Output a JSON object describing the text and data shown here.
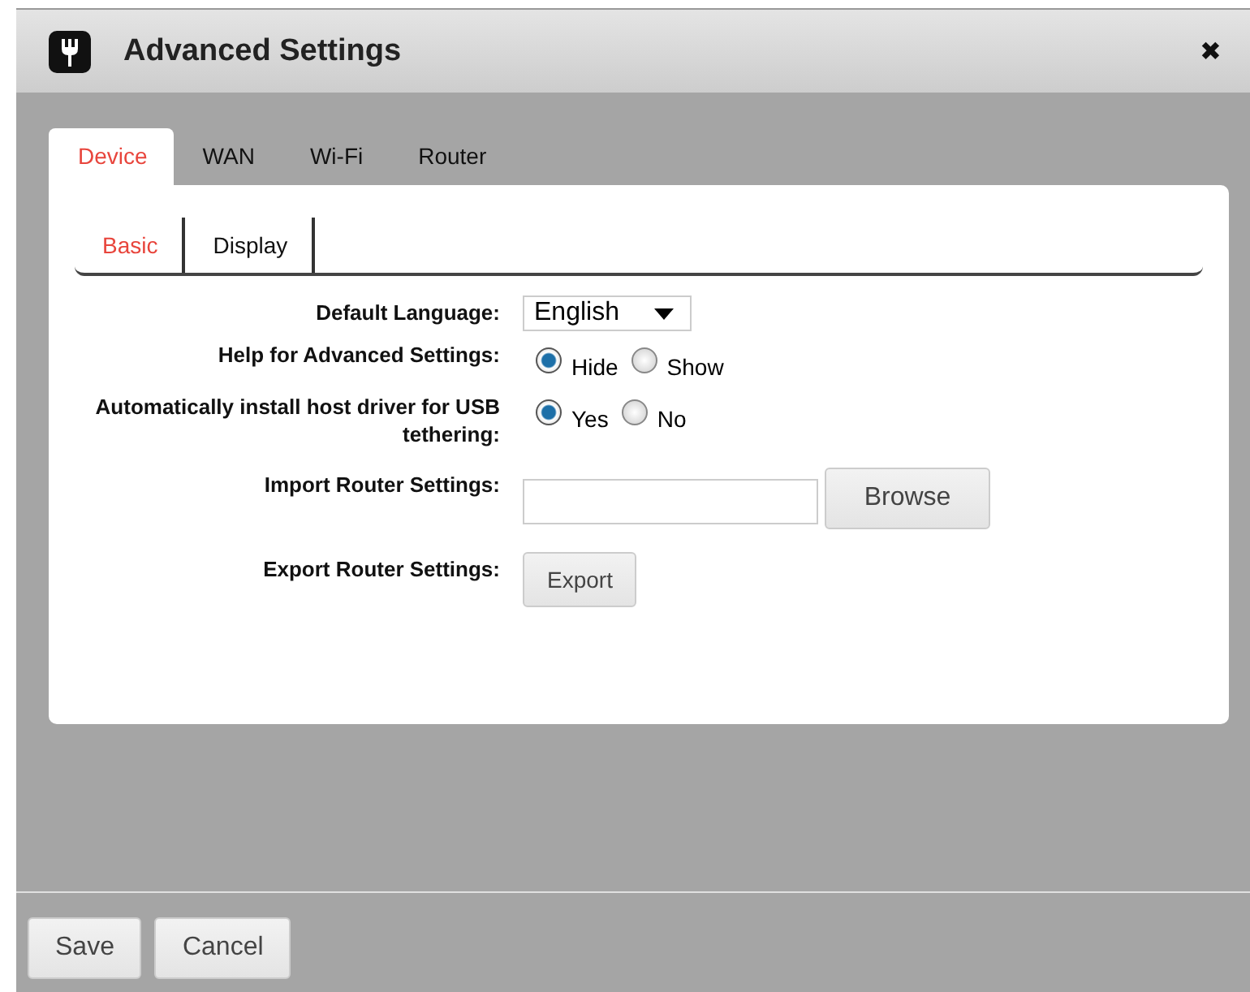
{
  "window": {
    "title": "Advanced Settings",
    "close": "✖"
  },
  "tabs": [
    {
      "label": "Device",
      "selected": true
    },
    {
      "label": "WAN",
      "selected": false
    },
    {
      "label": "Wi-Fi",
      "selected": false
    },
    {
      "label": "Router",
      "selected": false
    }
  ],
  "subtabs": [
    {
      "label": "Basic",
      "selected": true
    },
    {
      "label": "Display",
      "selected": false
    }
  ],
  "settings": [
    {
      "kind": "select",
      "label": "Default Language:",
      "value": "English"
    },
    {
      "kind": "radio",
      "label": "Help for Advanced Settings:",
      "options": [
        {
          "label": "Hide",
          "selected": true
        },
        {
          "label": "Show",
          "selected": false
        }
      ]
    },
    {
      "kind": "radio",
      "label": "Automatically install host driver for USB tethering:",
      "options": [
        {
          "label": "Yes",
          "selected": true
        },
        {
          "label": "No",
          "selected": false
        }
      ]
    },
    {
      "kind": "file",
      "label": "Import Router Settings:",
      "button": "Browse"
    },
    {
      "kind": "button",
      "label": "Export Router Settings:",
      "button": "Export"
    }
  ],
  "buttons": [
    "Save",
    "Cancel"
  ]
}
